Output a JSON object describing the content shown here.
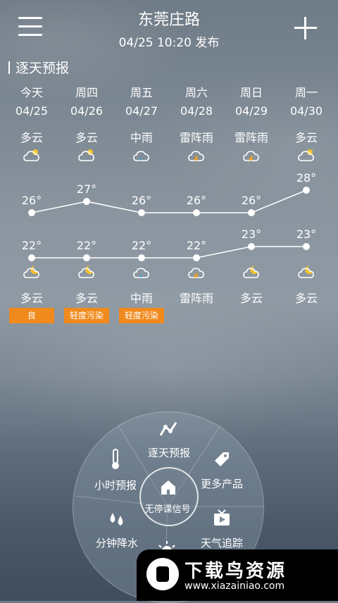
{
  "header": {
    "title": "东莞庄路",
    "subtitle": "04/25  10:20 发布"
  },
  "section": {
    "title": "逐天预报"
  },
  "days": [
    {
      "weekday": "今天",
      "date": "04/25",
      "day_weather": "多云",
      "day_icon": "cloud-sun-icon",
      "high": "26°",
      "high_value": 26,
      "low": "22°",
      "low_value": 22,
      "night_icon": "cloud-moon-icon",
      "night_weather": "多云",
      "aqi": "良"
    },
    {
      "weekday": "周四",
      "date": "04/26",
      "day_weather": "多云",
      "day_icon": "cloud-sun-icon",
      "high": "27°",
      "high_value": 27,
      "low": "22°",
      "low_value": 22,
      "night_icon": "cloud-moon-icon",
      "night_weather": "多云",
      "aqi": "轻度污染"
    },
    {
      "weekday": "周五",
      "date": "04/27",
      "day_weather": "中雨",
      "day_icon": "rain-icon",
      "high": "26°",
      "high_value": 26,
      "low": "22°",
      "low_value": 22,
      "night_icon": "rain-icon",
      "night_weather": "中雨",
      "aqi": "轻度污染"
    },
    {
      "weekday": "周六",
      "date": "04/28",
      "day_weather": "雷阵雨",
      "day_icon": "thunderstorm-icon",
      "high": "26°",
      "high_value": 26,
      "low": "22°",
      "low_value": 22,
      "night_icon": "thunderstorm-icon",
      "night_weather": "雷阵雨",
      "aqi": ""
    },
    {
      "weekday": "周日",
      "date": "04/29",
      "day_weather": "雷阵雨",
      "day_icon": "thunderstorm-icon",
      "high": "26°",
      "high_value": 26,
      "low": "23°",
      "low_value": 23,
      "night_icon": "moon-cloud-icon",
      "night_weather": "多云",
      "aqi": ""
    },
    {
      "weekday": "周一",
      "date": "04/30",
      "day_weather": "多云",
      "day_icon": "cloud-sun-icon",
      "high": "28°",
      "high_value": 28,
      "low": "23°",
      "low_value": 23,
      "night_icon": "moon-cloud-icon",
      "night_weather": "多云",
      "aqi": ""
    }
  ],
  "wheel": {
    "center": "无停课信号",
    "items": {
      "daily": "逐天预报",
      "hourly": "小时预报",
      "more": "更多产品",
      "minute": "分钟降水",
      "tracking": "天气追踪"
    }
  },
  "watermark": {
    "title": "下载鸟资源",
    "url": "www.xiazainiao.com"
  },
  "colors": {
    "aqi_badge": "#f08a1c",
    "line": "#ffffff"
  }
}
